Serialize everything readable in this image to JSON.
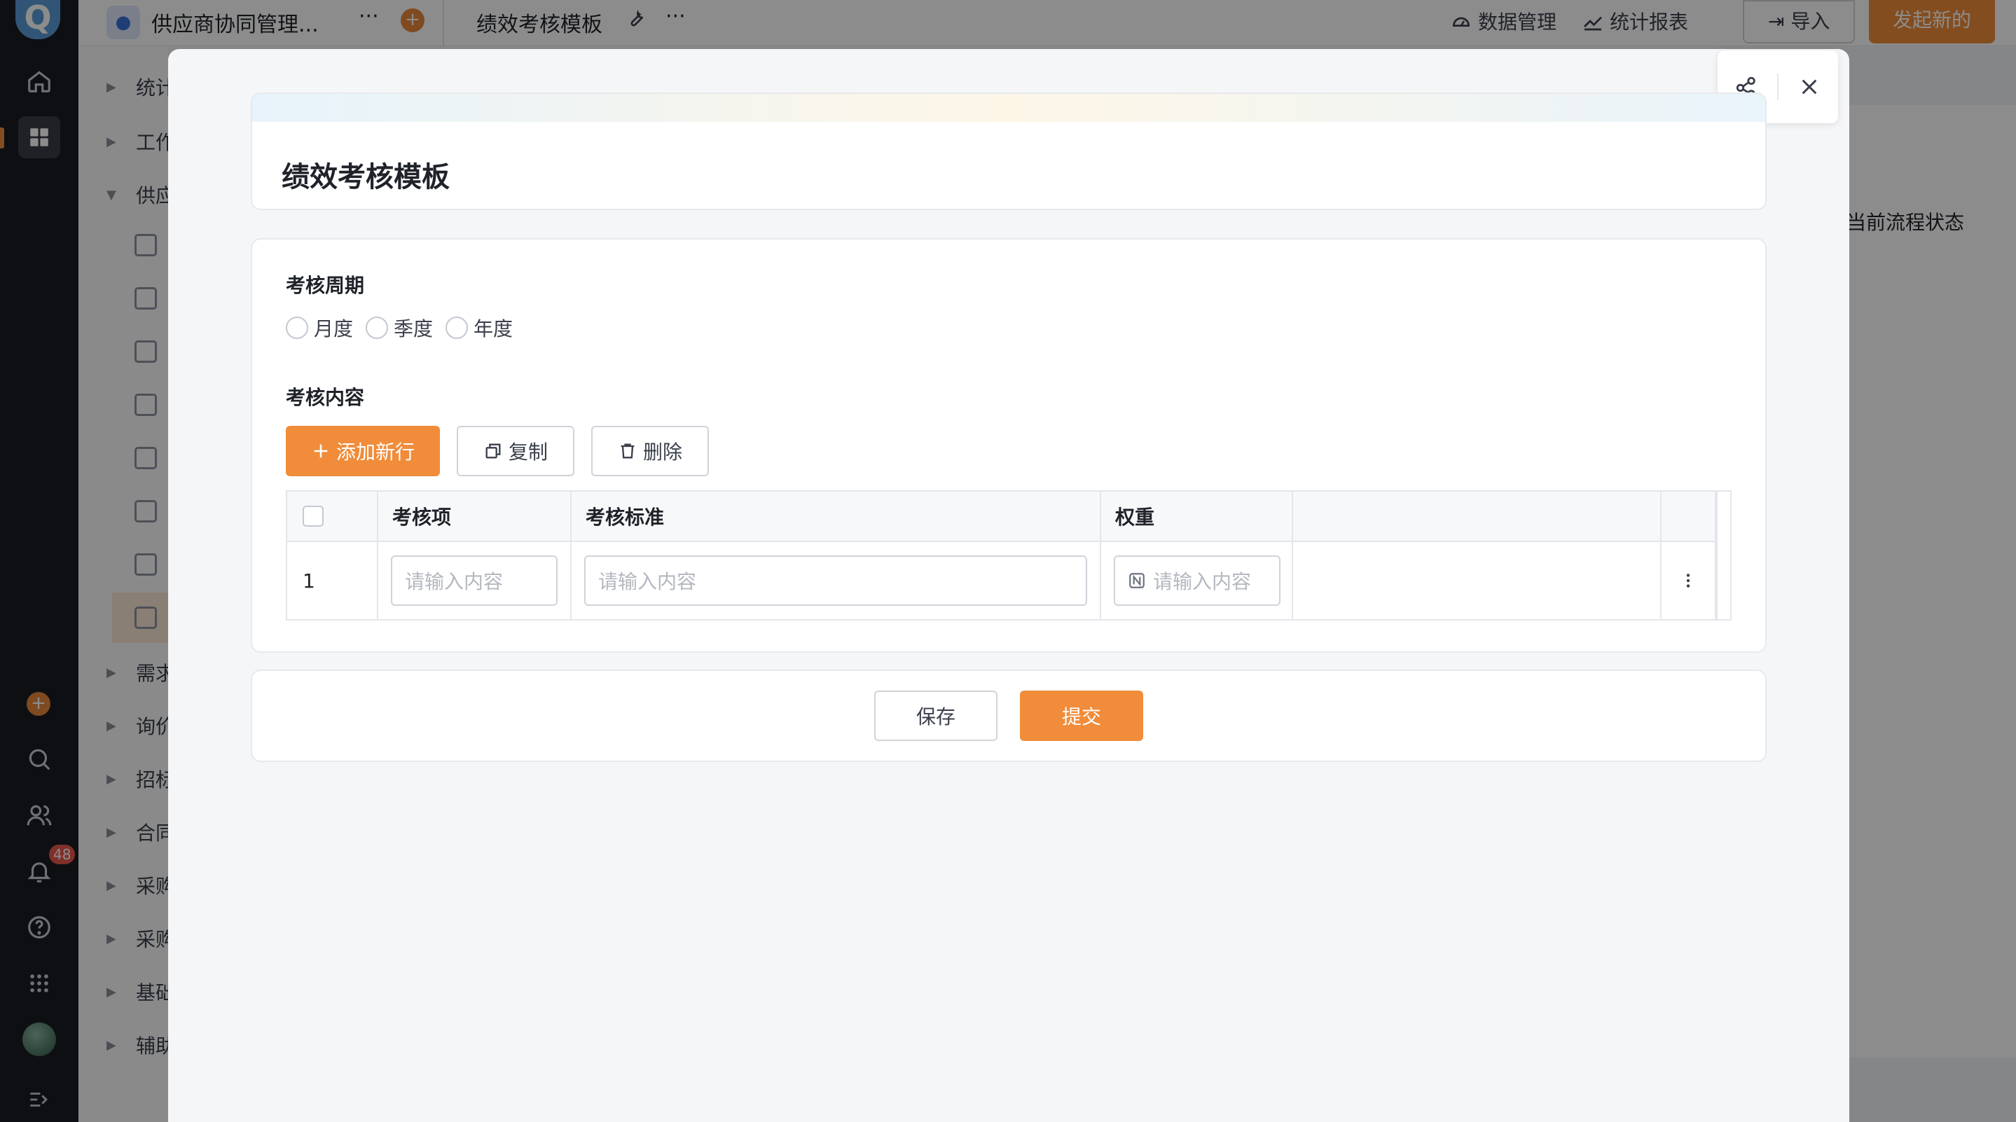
{
  "app": {
    "name": "供应商协同管理...",
    "current_form": "绩效考核模板",
    "notification_count": "48",
    "accent": "#F08C3A"
  },
  "nav": {
    "groups": [
      "统计",
      "工作",
      "供应",
      "需求",
      "询价",
      "招标",
      "合同",
      "采购",
      "采购",
      "基础",
      "辅助"
    ]
  },
  "topbar": {
    "data_mgmt": "数据管理",
    "stats_report": "统计报表",
    "import": "导入",
    "start_new": "发起新的"
  },
  "background": {
    "column_header": "当前流程状态"
  },
  "modal": {
    "title": "绩效考核模板",
    "period": {
      "label": "考核周期",
      "options": [
        "月度",
        "季度",
        "年度"
      ]
    },
    "content": {
      "label": "考核内容",
      "add_row": "添加新行",
      "copy": "复制",
      "delete": "删除",
      "columns": [
        "考核项",
        "考核标准",
        "权重"
      ],
      "rows": [
        {
          "index": "1",
          "item_placeholder": "请输入内容",
          "standard_placeholder": "请输入内容",
          "weight_placeholder": "请输入内容"
        }
      ]
    },
    "actions": {
      "save": "保存",
      "submit": "提交"
    }
  }
}
